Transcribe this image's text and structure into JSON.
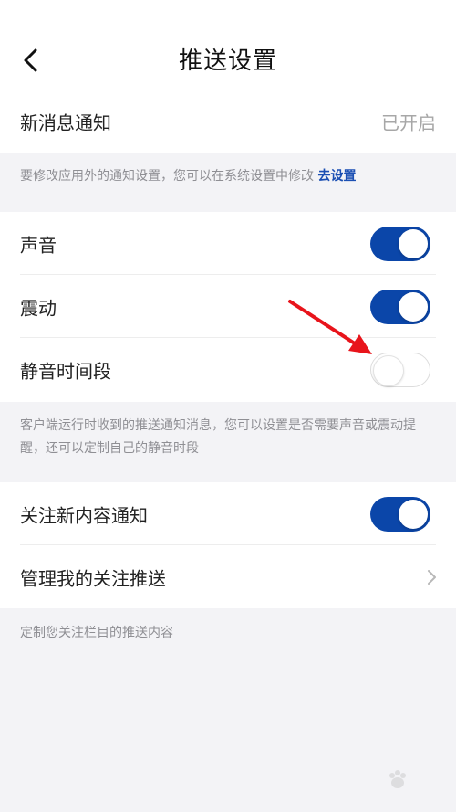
{
  "header": {
    "title": "推送设置"
  },
  "new_message": {
    "label": "新消息通知",
    "status": "已开启"
  },
  "system_note": {
    "text": "要修改应用外的通知设置，您可以在系统设置中修改",
    "link": "去设置"
  },
  "sound_settings": {
    "items": [
      {
        "label": "声音",
        "enabled": true
      },
      {
        "label": "震动",
        "enabled": true
      },
      {
        "label": "静音时间段",
        "enabled": false
      }
    ]
  },
  "sound_note": {
    "text": "客户端运行时收到的推送通知消息，您可以设置是否需要声音或震动提醒，还可以定制自己的静音时段"
  },
  "follow_settings": {
    "new_content": {
      "label": "关注新内容通知",
      "enabled": true
    },
    "manage": {
      "label": "管理我的关注推送"
    }
  },
  "follow_note": {
    "text": "定制您关注栏目的推送内容"
  },
  "colors": {
    "toggle_on": "#0b46a9",
    "link": "#1b4fb3",
    "annotation_arrow": "#e8141b"
  },
  "icons": {
    "back": "chevron-left-icon",
    "chevron": "chevron-right-icon",
    "annotation": "red-arrow-icon"
  }
}
